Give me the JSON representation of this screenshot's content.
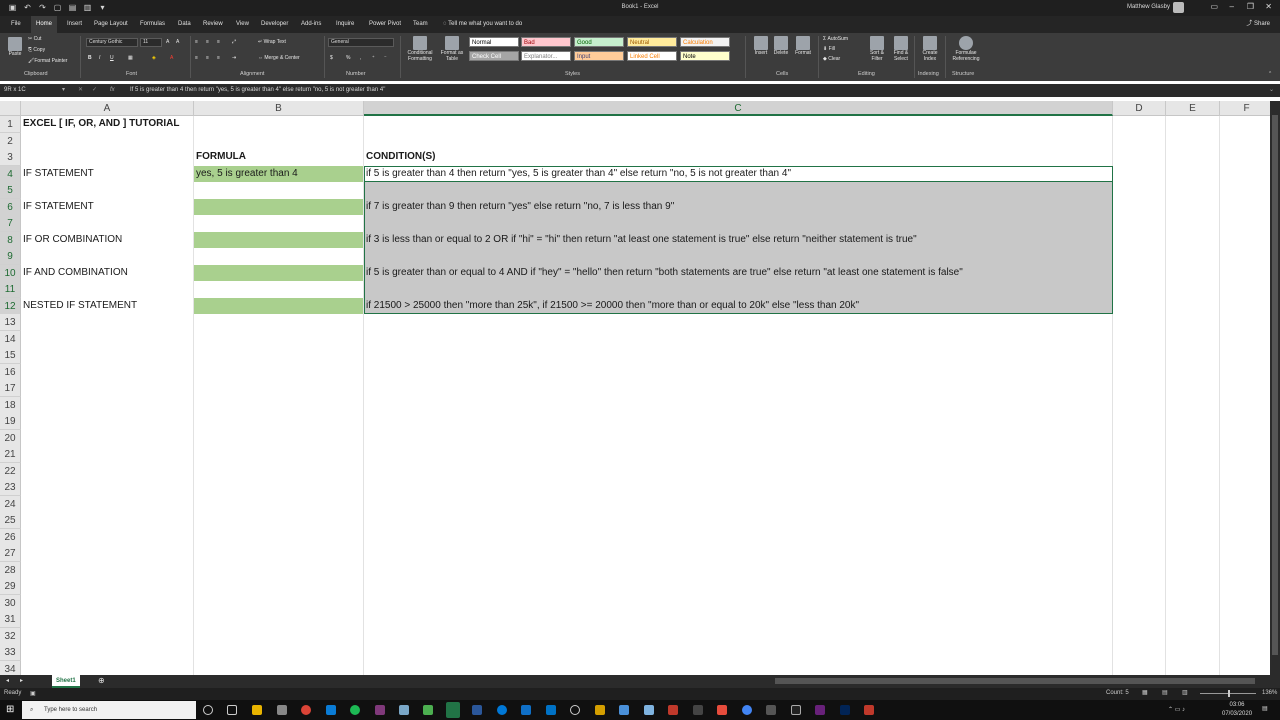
{
  "titlebar": {
    "title": "Book1 - Excel",
    "user": "Matthew Glasby"
  },
  "tabs": [
    "File",
    "Home",
    "Insert",
    "Page Layout",
    "Formulas",
    "Data",
    "Review",
    "View",
    "Developer",
    "Add-ins",
    "Inquire",
    "Power Pivot",
    "Team"
  ],
  "tell_me": "Tell me what you want to do",
  "share": "Share",
  "ribbon": {
    "clipboard": {
      "paste": "Paste",
      "cut": "Cut",
      "copy": "Copy",
      "format_painter": "Format Painter",
      "label": "Clipboard"
    },
    "font": {
      "name": "Century Gothic",
      "size": "11",
      "label": "Font"
    },
    "alignment": {
      "wrap_text": "Wrap Text",
      "merge": "Merge & Center",
      "label": "Alignment"
    },
    "number": {
      "format": "General",
      "label": "Number"
    },
    "styles": {
      "conditional": "Conditional Formatting",
      "format_table": "Format as Table",
      "label": "Styles",
      "cells": [
        {
          "name": "Normal",
          "bg": "#ffffff",
          "fg": "#000000"
        },
        {
          "name": "Bad",
          "bg": "#ffc7ce",
          "fg": "#9c0006"
        },
        {
          "name": "Good",
          "bg": "#c6efce",
          "fg": "#006100"
        },
        {
          "name": "Neutral",
          "bg": "#ffeb9c",
          "fg": "#9c5700"
        },
        {
          "name": "Calculation",
          "bg": "#f2f2f2",
          "fg": "#fa7d00"
        },
        {
          "name": "Check Cell",
          "bg": "#a5a5a5",
          "fg": "#ffffff"
        },
        {
          "name": "Explanator...",
          "bg": "#ffffff",
          "fg": "#7f7f7f"
        },
        {
          "name": "Input",
          "bg": "#ffcc99",
          "fg": "#3f3f76"
        },
        {
          "name": "Linked Cell",
          "bg": "#ffffff",
          "fg": "#fa7d00"
        },
        {
          "name": "Note",
          "bg": "#ffffcc",
          "fg": "#000000"
        }
      ]
    },
    "cells_group": {
      "insert": "Insert",
      "delete": "Delete",
      "format": "Format",
      "label": "Cells"
    },
    "editing": {
      "autosum": "AutoSum",
      "fill": "Fill",
      "clear": "Clear",
      "sort": "Sort & Filter",
      "find": "Find & Select",
      "label": "Editing"
    },
    "indexing": {
      "create": "Create Index",
      "label": "Indexing"
    },
    "structure": {
      "formula_ref": "Formulae Referencing",
      "label": "Structure"
    }
  },
  "formula_bar": {
    "name_box": "9R x 1C",
    "fx": "fx",
    "content": "If 5 is greater than 4 then return \"yes, 5 is greater than 4\" else return \"no, 5 is not greater than 4\""
  },
  "columns": [
    "A",
    "B",
    "C",
    "D",
    "E",
    "F"
  ],
  "rows": [
    "1",
    "2",
    "3",
    "4",
    "5",
    "6",
    "7",
    "8",
    "9",
    "10",
    "11",
    "12",
    "13",
    "14",
    "15",
    "16",
    "17",
    "18",
    "19",
    "20",
    "21",
    "22",
    "23",
    "24",
    "25",
    "26",
    "27",
    "28",
    "29",
    "30",
    "31",
    "32",
    "33",
    "34"
  ],
  "cells": {
    "A1": "EXCEL [ IF, OR, AND ] TUTORIAL",
    "B3": "FORMULA",
    "C3": "CONDITION(S)",
    "A4": "IF STATEMENT",
    "B4": "yes, 5 is greater than 4",
    "C4": "if 5 is greater than 4 then return \"yes, 5 is greater than 4\" else return \"no, 5 is not greater than 4\"",
    "A6": "IF STATEMENT",
    "C6": "if 7 is greater than 9 then return \"yes\" else return \"no, 7 is less than 9\"",
    "A8": "IF OR COMBINATION",
    "C8": "if 3 is less than or equal to 2 OR if \"hi\" = \"hi\" then return \"at least one statement is true\" else return \"neither statement is true\"",
    "A10": "IF AND COMBINATION",
    "C10": "if 5 is greater than or equal to 4 AND if \"hey\" = \"hello\" then return \"both statements are true\" else return \"at least one statement is false\"",
    "A12": "NESTED IF STATEMENT",
    "C12": "if 21500 > 25000 then \"more than 25k\", if 21500 >= 20000 then \"more than or equal to 20k\" else \"less than 20k\""
  },
  "sheet_tab": "Sheet1",
  "status": {
    "ready": "Ready",
    "count": "Count: 5",
    "zoom": "136%"
  },
  "taskbar": {
    "search": "Type here to search",
    "time": "03:06",
    "date": "07/03/2020"
  },
  "colors": {
    "excel_green": "#217346",
    "cell_green": "#a9d08e",
    "selection_gray": "#c8c8c8"
  }
}
